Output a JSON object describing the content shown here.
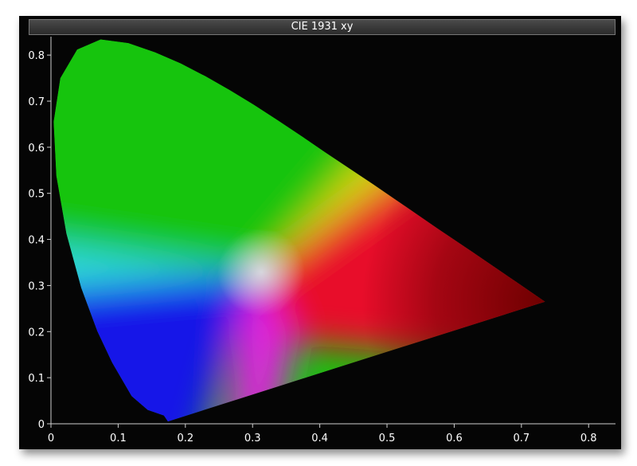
{
  "chart_data": {
    "type": "scatter",
    "title": "CIE 1931 xy",
    "xlabel": "",
    "ylabel": "",
    "xlim": [
      0,
      0.84
    ],
    "ylim": [
      0,
      0.84
    ],
    "grid": false,
    "legend": "none",
    "x_ticks": [
      "0",
      "0.1",
      "0.2",
      "0.3",
      "0.4",
      "0.5",
      "0.6",
      "0.7",
      "0.8"
    ],
    "y_ticks": [
      "0",
      "0.1",
      "0.2",
      "0.3",
      "0.4",
      "0.5",
      "0.6",
      "0.7",
      "0.8"
    ],
    "x_tick_values": [
      0,
      0.1,
      0.2,
      0.3,
      0.4,
      0.5,
      0.6,
      0.7,
      0.8
    ],
    "y_tick_values": [
      0,
      0.1,
      0.2,
      0.3,
      0.4,
      0.5,
      0.6,
      0.7,
      0.8
    ],
    "spectral_locus": [
      {
        "x": 0.174,
        "y": 0.005
      },
      {
        "x": 0.168,
        "y": 0.018
      },
      {
        "x": 0.144,
        "y": 0.03
      },
      {
        "x": 0.12,
        "y": 0.06
      },
      {
        "x": 0.091,
        "y": 0.133
      },
      {
        "x": 0.069,
        "y": 0.201
      },
      {
        "x": 0.045,
        "y": 0.295
      },
      {
        "x": 0.023,
        "y": 0.413
      },
      {
        "x": 0.008,
        "y": 0.538
      },
      {
        "x": 0.004,
        "y": 0.655
      },
      {
        "x": 0.014,
        "y": 0.75
      },
      {
        "x": 0.039,
        "y": 0.812
      },
      {
        "x": 0.074,
        "y": 0.834
      },
      {
        "x": 0.115,
        "y": 0.826
      },
      {
        "x": 0.155,
        "y": 0.806
      },
      {
        "x": 0.193,
        "y": 0.782
      },
      {
        "x": 0.23,
        "y": 0.754
      },
      {
        "x": 0.266,
        "y": 0.724
      },
      {
        "x": 0.302,
        "y": 0.692
      },
      {
        "x": 0.337,
        "y": 0.659
      },
      {
        "x": 0.373,
        "y": 0.624
      },
      {
        "x": 0.408,
        "y": 0.589
      },
      {
        "x": 0.444,
        "y": 0.554
      },
      {
        "x": 0.479,
        "y": 0.52
      },
      {
        "x": 0.512,
        "y": 0.487
      },
      {
        "x": 0.575,
        "y": 0.424
      },
      {
        "x": 0.627,
        "y": 0.373
      },
      {
        "x": 0.666,
        "y": 0.334
      },
      {
        "x": 0.692,
        "y": 0.308
      },
      {
        "x": 0.735,
        "y": 0.265
      }
    ],
    "white_point": {
      "x": 0.3127,
      "y": 0.329
    }
  },
  "colors": {
    "background": "#050505",
    "axis": "#d0d0d0",
    "text": "#ffffff",
    "white_point": "#e8f0f8",
    "green_region": "#16c40e",
    "cyan_region": "#2dd8d8",
    "blue_region": "#1418e8",
    "magenta_region": "#e020e0",
    "red_region": "#e8102a",
    "yellow_region": "#d8d810",
    "dark_red": "#6e0000"
  }
}
